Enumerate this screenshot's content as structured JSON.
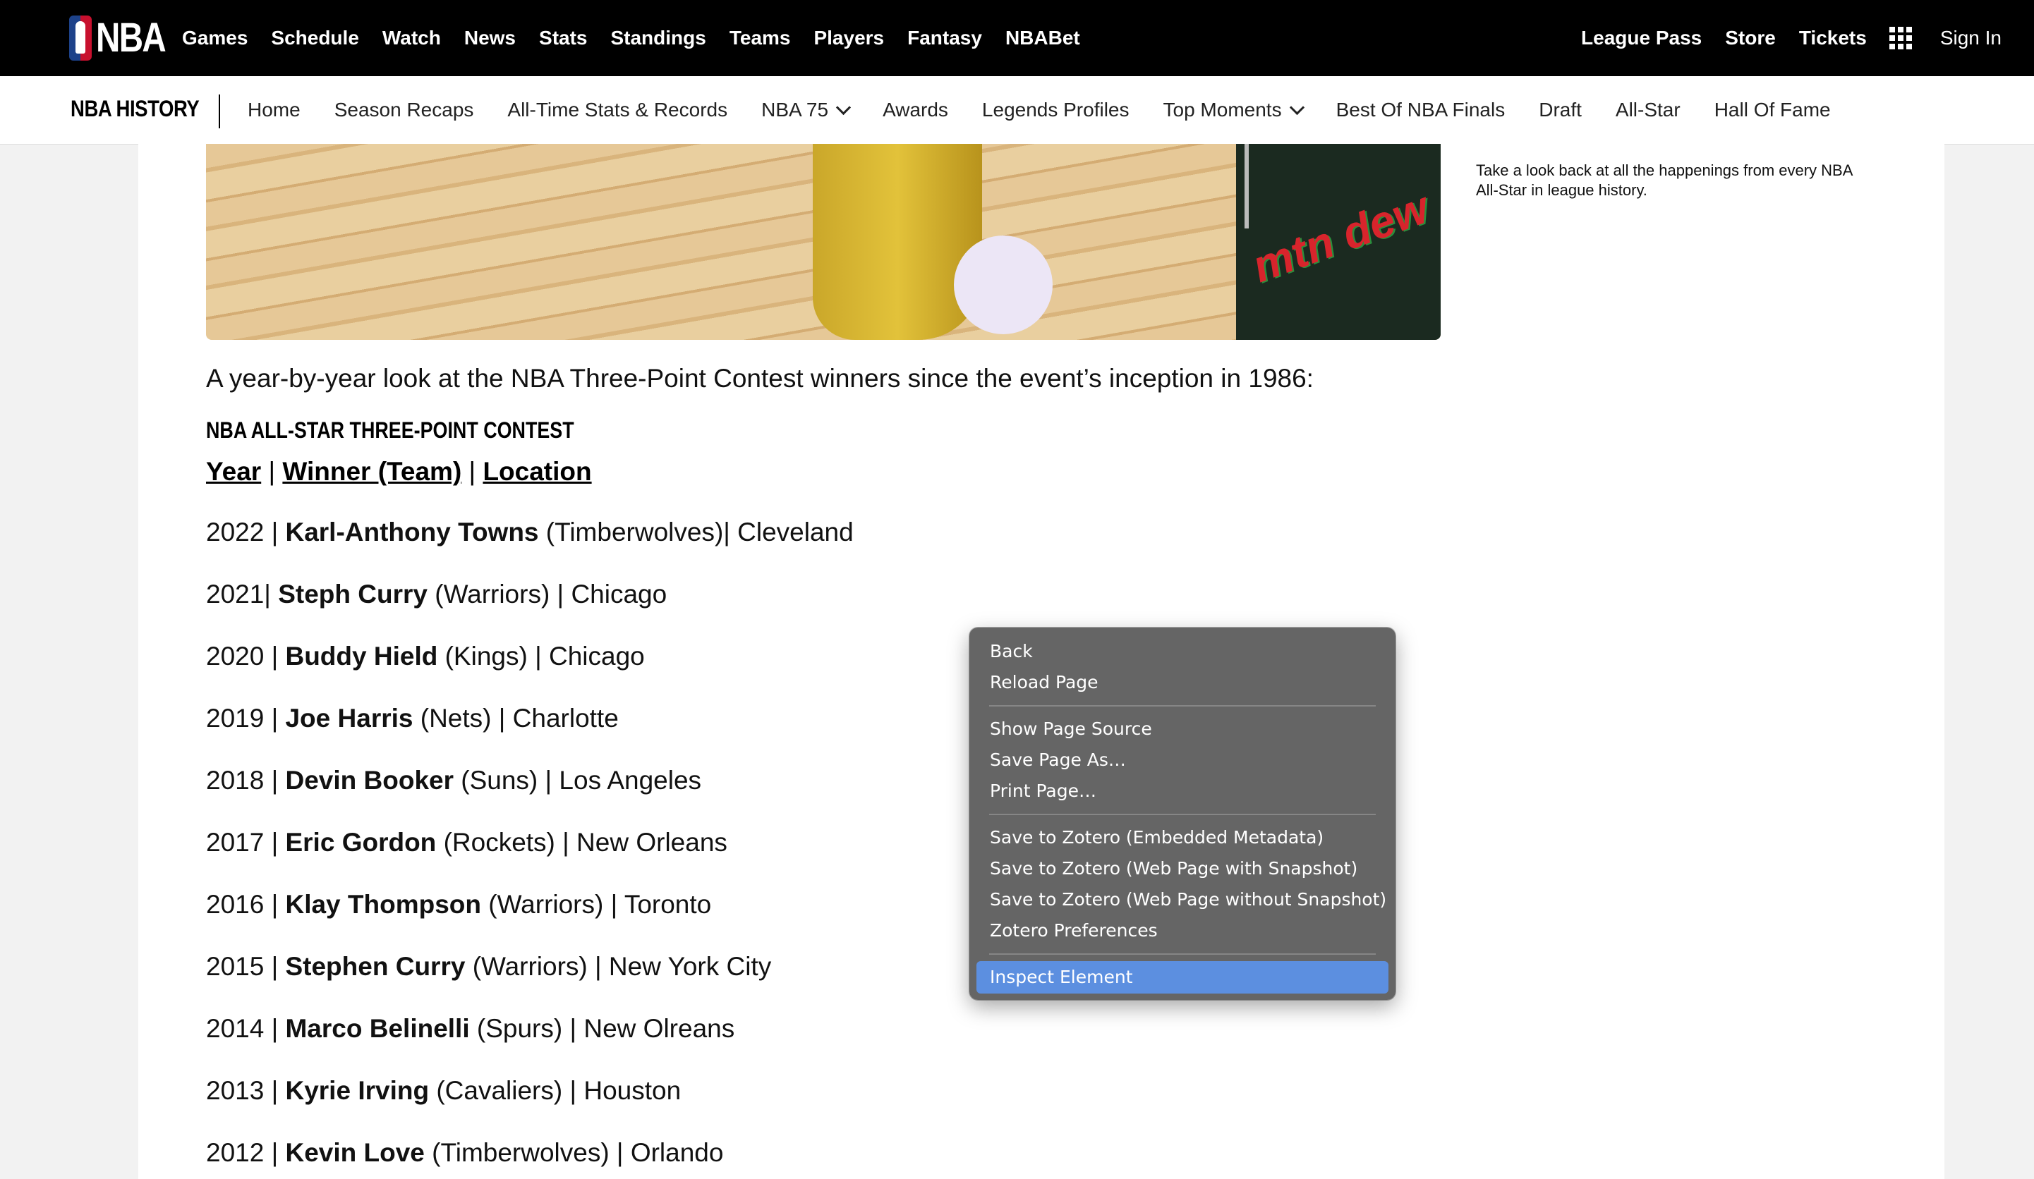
{
  "topnav": {
    "logo_text": "NBA",
    "items": [
      "Games",
      "Schedule",
      "Watch",
      "News",
      "Stats",
      "Standings",
      "Teams",
      "Players",
      "Fantasy",
      "NBABet"
    ],
    "right_items": [
      "League Pass",
      "Store",
      "Tickets"
    ],
    "sign_in": "Sign In"
  },
  "subnav": {
    "brand": "NBA HISTORY",
    "links": [
      "Home",
      "Season Recaps",
      "All-Time Stats & Records",
      "NBA 75",
      "Awards",
      "Legends Profiles",
      "Top Moments",
      "Best Of NBA Finals",
      "Draft",
      "All-Star",
      "Hall Of Fame"
    ]
  },
  "hero": {
    "sponsor_text": "mtn dew"
  },
  "sidebar": {
    "text": "Take a look back at all the happenings from every NBA All-Star in league history."
  },
  "article": {
    "intro": "A year-by-year look at the NBA Three-Point Contest winners since the event’s inception in 1986:",
    "section_title": "NBA ALL-STAR THREE-POINT CONTEST",
    "col_year": "Year",
    "col_winner": "Winner (Team)",
    "col_location": "Location",
    "sep": " | ",
    "rows": [
      {
        "pre": "2022 | ",
        "name": "Karl-Anthony Towns",
        "post": " (Timberwolves)| Cleveland"
      },
      {
        "pre": "2021| ",
        "name": "Steph Curry",
        "post": " (Warriors) | Chicago"
      },
      {
        "pre": "2020 | ",
        "name": "Buddy Hield",
        "post": " (Kings) | Chicago"
      },
      {
        "pre": "2019 | ",
        "name": "Joe Harris",
        "post": " (Nets) | Charlotte"
      },
      {
        "pre": "2018 | ",
        "name": "Devin Booker",
        "post": " (Suns) | Los Angeles"
      },
      {
        "pre": "2017 | ",
        "name": "Eric Gordon",
        "post": " (Rockets) | New Orleans"
      },
      {
        "pre": "2016 | ",
        "name": "Klay Thompson",
        "post": " (Warriors) | Toronto"
      },
      {
        "pre": "2015 | ",
        "name": "Stephen Curry",
        "post": " (Warriors) | New York City"
      },
      {
        "pre": "2014 | ",
        "name": "Marco Belinelli",
        "post": " (Spurs) | New Olreans"
      },
      {
        "pre": "2013 | ",
        "name": "Kyrie Irving",
        "post": " (Cavaliers) | Houston"
      },
      {
        "pre": "2012 | ",
        "name": "Kevin Love",
        "post": " (Timberwolves) | Orlando"
      }
    ]
  },
  "context_menu": {
    "back": "Back",
    "reload": "Reload Page",
    "source": "Show Page Source",
    "save_as": "Save Page As…",
    "print": "Print Page…",
    "zotero_meta": "Save to Zotero (Embedded Metadata)",
    "zotero_snap": "Save to Zotero (Web Page with Snapshot)",
    "zotero_nosnap": "Save to Zotero (Web Page without Snapshot)",
    "zotero_prefs": "Zotero Preferences",
    "inspect": "Inspect Element",
    "highlight_color": "#5c8fe0"
  }
}
